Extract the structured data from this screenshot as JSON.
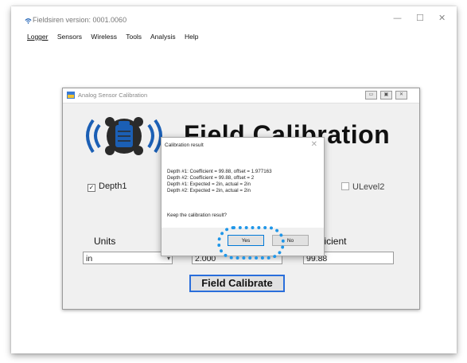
{
  "app": {
    "title": "Fieldsiren version: 0001.0060",
    "controls": {
      "minimize": "—",
      "maximize": "☐",
      "close": "✕"
    }
  },
  "menu": [
    "Logger",
    "Sensors",
    "Wireless",
    "Tools",
    "Analysis",
    "Help"
  ],
  "calibration_window": {
    "title": "Analog Sensor Calibration",
    "heading": "Field Calibration",
    "checkboxes": {
      "depth1": "Depth1",
      "ulevel2": "ULevel2"
    },
    "units_label": "Units",
    "units_value": "in",
    "target_value": "2.000",
    "coefficient_label": "fficient",
    "coefficient_value": "99.88",
    "field_calibrate_button": "Field Calibrate"
  },
  "dialog": {
    "title": "Calibration result",
    "lines": [
      "Depth #1: Coefficient = 99.88, offset = 1.977163",
      "Depth #2: Coefficient = 99.88, offset = 2",
      "Depth #1: Expected = 2in, actual = 2in",
      "Depth #2: Expected = 2in, actual = 2in"
    ],
    "question": "Keep the calibration result?",
    "yes": "Yes",
    "no": "No"
  },
  "colors": {
    "highlight": "#1f96e8",
    "logo_blue": "#1b5fb5",
    "button_focus": "#2a6edb"
  }
}
